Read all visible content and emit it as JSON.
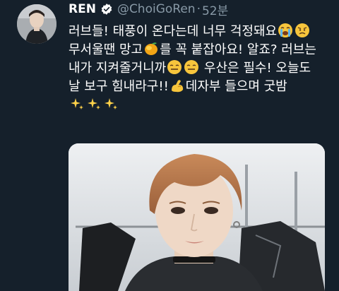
{
  "tweet": {
    "display_name": "REN",
    "handle": "@ChoiGoRen",
    "separator": "·",
    "time": "52분",
    "lines": [
      "러브들! 태풍이 온다는데 너무 걱정돼요",
      "무서울땐 망고",
      "를 꼭 붙잡아요! 알죠? 러브는",
      "내가 지켜줄거니까",
      " 우산은 필수! 오늘도",
      "날 보구 힘내라구!!",
      "데자부 들으며 굿밤"
    ],
    "icons": {
      "verified": "verified-badge-icon",
      "crying": "loudly-crying-face-emoji",
      "worried": "worried-face-emoji",
      "mango": "mango-emoji",
      "grin": "grimacing-smile-emoji",
      "muscle": "flexed-biceps-emoji",
      "sparkles": "sparkles-emoji"
    }
  },
  "colors": {
    "background": "#15202b",
    "text": "#ffffff",
    "secondary_text": "#8899a6",
    "verified": "#ffffff"
  }
}
